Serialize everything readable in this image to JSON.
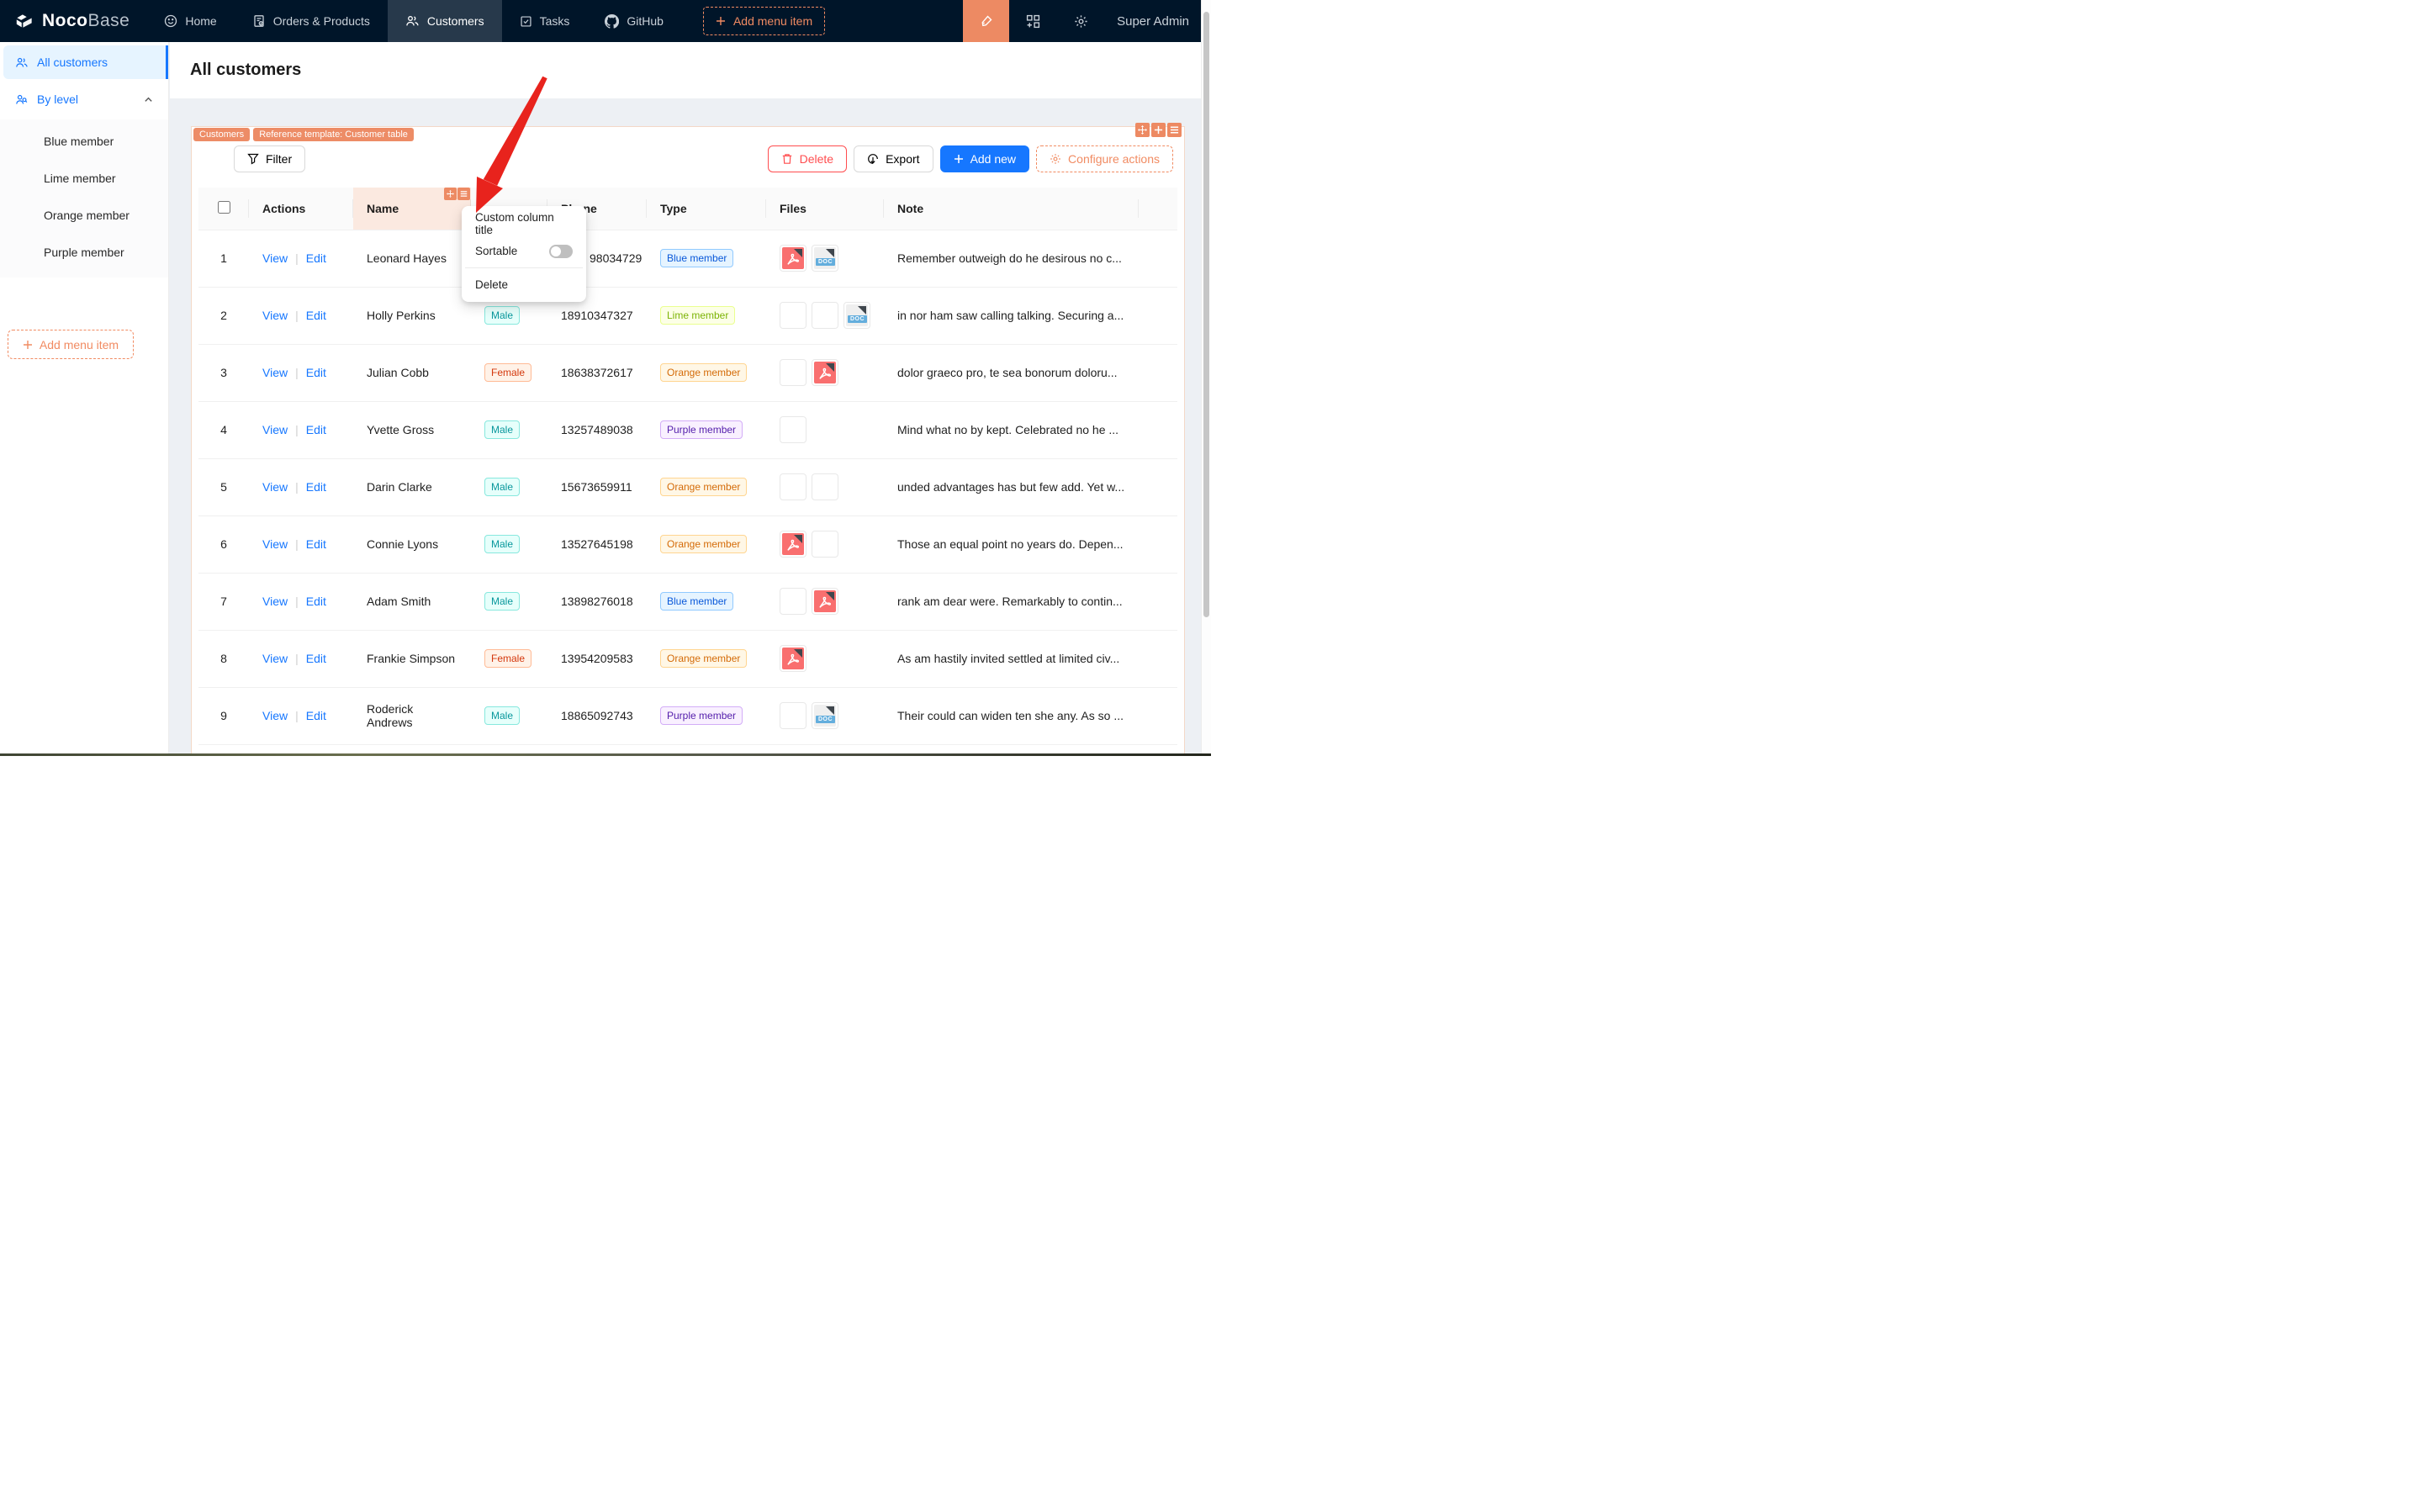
{
  "colors": {
    "navbar_bg": "#001529",
    "accent_orange": "#F18B62",
    "primary_blue": "#1677FF",
    "danger_red": "#FF4D4F",
    "selected_menu_bg": "#E6F4FF",
    "arrow_red": "#E8231D",
    "tag_cyan_text": "#08979C",
    "tag_volcano_text": "#D4380D",
    "tag_blue_text": "#0958D9",
    "tag_lime_text": "#7CB305",
    "tag_orange_text": "#D46B08",
    "tag_purple_text": "#531DAB"
  },
  "navbar": {
    "logo": {
      "noco": "Noco",
      "base": "Base"
    },
    "items": [
      {
        "label": "Home",
        "icon": "smile-icon"
      },
      {
        "label": "Orders & Products",
        "icon": "orders-icon"
      },
      {
        "label": "Customers",
        "icon": "users-icon",
        "active": true
      },
      {
        "label": "Tasks",
        "icon": "tasks-icon"
      },
      {
        "label": "GitHub",
        "icon": "github-icon"
      },
      {
        "label": "Add menu item",
        "icon": "plus-icon",
        "dashed": true
      }
    ],
    "user": "Super Admin"
  },
  "sidebar": {
    "items": [
      {
        "label": "All customers",
        "active": true
      },
      {
        "label": "By level",
        "parent": true
      }
    ],
    "sub_items": [
      {
        "label": "Blue member"
      },
      {
        "label": "Lime member"
      },
      {
        "label": "Orange member"
      },
      {
        "label": "Purple member"
      }
    ],
    "add_label": "Add menu item"
  },
  "page": {
    "title": "All customers"
  },
  "block": {
    "tags": [
      "Customers",
      "Reference template: Customer table"
    ]
  },
  "toolbar": {
    "filter_label": "Filter",
    "delete_label": "Delete",
    "export_label": "Export",
    "add_new_label": "Add new",
    "configure_actions_label": "Configure actions"
  },
  "labels": {
    "view": "View",
    "edit": "Edit",
    "doc_badge": "DOC"
  },
  "column_menu": {
    "items": {
      "custom_title": "Custom column title",
      "sortable": "Sortable",
      "delete": "Delete"
    },
    "sortable_on": false
  },
  "table": {
    "columns": [
      {
        "label": ""
      },
      {
        "label": "Actions"
      },
      {
        "label": "Name"
      },
      {
        "label": ""
      },
      {
        "label": "Phone"
      },
      {
        "label": "Type"
      },
      {
        "label": "Files"
      },
      {
        "label": "Note"
      }
    ],
    "rows": [
      {
        "index": "1",
        "name": "Leonard Hayes",
        "gender": "",
        "phone": "98034729",
        "phone_partial": true,
        "type": "Blue member",
        "type_color": "blue",
        "files": [
          "pdf",
          "doc"
        ],
        "note": "Remember outweigh do he desirous no c..."
      },
      {
        "index": "2",
        "name": "Holly Perkins",
        "gender": "Male",
        "phone": "18910347327",
        "phone_partial": false,
        "type": "Lime member",
        "type_color": "lime",
        "files": [
          "img-pomegranate",
          "img-grapes",
          "doc"
        ],
        "note": "in nor ham saw calling talking. Securing a..."
      },
      {
        "index": "3",
        "name": "Julian Cobb",
        "gender": "Female",
        "phone": "18638372617",
        "phone_partial": false,
        "type": "Orange member",
        "type_color": "orange",
        "files": [
          "img-collage",
          "pdf"
        ],
        "note": "dolor graeco pro, te sea bonorum doloru..."
      },
      {
        "index": "4",
        "name": "Yvette Gross",
        "gender": "Male",
        "phone": "13257489038",
        "phone_partial": false,
        "type": "Purple member",
        "type_color": "purple",
        "files": [
          "img-pastries"
        ],
        "note": "Mind what no by kept. Celebrated no he ..."
      },
      {
        "index": "5",
        "name": "Darin Clarke",
        "gender": "Male",
        "phone": "15673659911",
        "phone_partial": false,
        "type": "Orange member",
        "type_color": "orange",
        "files": [
          "img-oranges",
          "img-pastries"
        ],
        "note": "unded advantages has but few add. Yet w..."
      },
      {
        "index": "6",
        "name": "Connie Lyons",
        "gender": "Male",
        "phone": "13527645198",
        "phone_partial": false,
        "type": "Orange member",
        "type_color": "orange",
        "files": [
          "pdf",
          "img-pomegranate"
        ],
        "note": "Those an equal point no years do. Depen..."
      },
      {
        "index": "7",
        "name": "Adam Smith",
        "gender": "Male",
        "phone": "13898276018",
        "phone_partial": false,
        "type": "Blue member",
        "type_color": "blue",
        "files": [
          "img-coffee",
          "pdf"
        ],
        "note": "rank am dear were. Remarkably to contin..."
      },
      {
        "index": "8",
        "name": "Frankie Simpson",
        "gender": "Female",
        "phone": "13954209583",
        "phone_partial": false,
        "type": "Orange member",
        "type_color": "orange",
        "files": [
          "pdf"
        ],
        "note": "As am hastily invited settled at limited civ..."
      },
      {
        "index": "9",
        "name": "Roderick Andrews",
        "gender": "Male",
        "phone": "18865092743",
        "phone_partial": false,
        "type": "Purple member",
        "type_color": "purple",
        "files": [
          "img-storefront",
          "doc"
        ],
        "note": "Their could can widen ten she any. As so ..."
      }
    ]
  },
  "gender_colors": {
    "Male": "cyan",
    "Female": "volcano"
  },
  "icons": {
    "drag-icon": "four-way arrows on orange square",
    "plus-icon": "+",
    "menu-icon": "☰",
    "gear-icon": "⚙",
    "smile-icon": "smiley face",
    "users-icon": "two people",
    "tasks-icon": "checked square",
    "github-icon": "github mark",
    "highlighter-icon": "ui editor pen",
    "filter-icon": "funnel",
    "trash-icon": "trash can",
    "download-icon": "circle with down arrow",
    "chevron-up-icon": "^"
  }
}
